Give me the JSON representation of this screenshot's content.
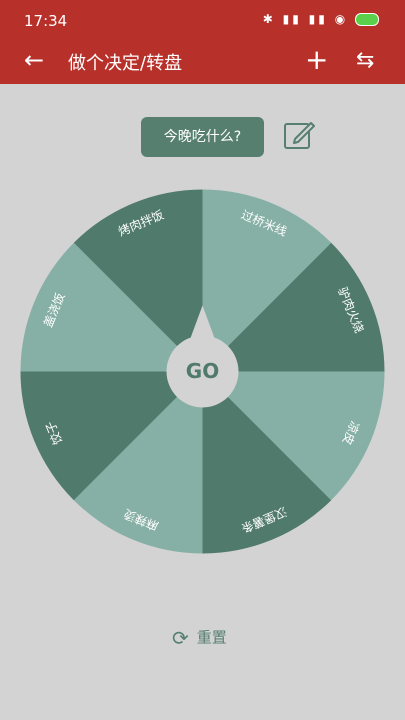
{
  "status": {
    "time": "17:34",
    "icons": "✱ ▮▮ ▮▮ ◉"
  },
  "appbar": {
    "back_icon": "arrow-left-icon",
    "title": "做个决定/转盘",
    "add_icon": "plus-icon",
    "swap_icon": "swap-icon"
  },
  "question": {
    "label": "今晚吃什么?"
  },
  "edit": {
    "icon": "edit-icon"
  },
  "wheel": {
    "go_label": "GO",
    "colors": {
      "dark": "#507a6c",
      "light": "#86b0a5",
      "hub": "#d3d3d3"
    },
    "segments": [
      "过桥米线",
      "驴肉火烧",
      "凉皮",
      "汉堡薯条",
      "麻辣烫",
      "饺子",
      "盖浇饭",
      "烤肉拌饭"
    ]
  },
  "reset": {
    "label": "重置",
    "icon": "refresh-icon"
  }
}
